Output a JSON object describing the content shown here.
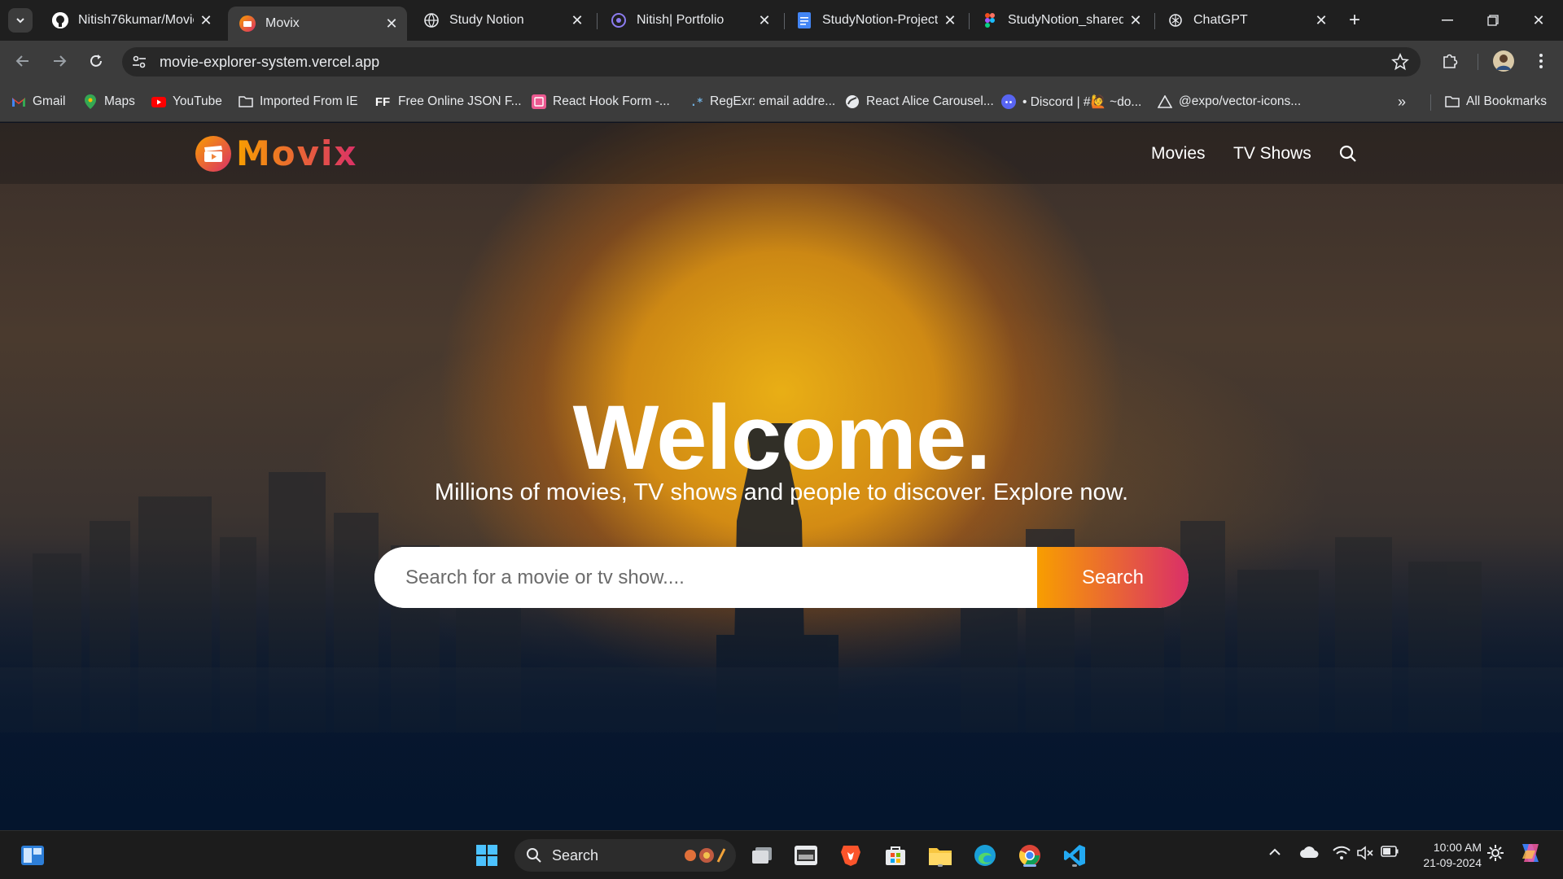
{
  "browser": {
    "tabs": [
      {
        "title": "Nitish76kumar/Movie",
        "icon": "github-icon",
        "active": false
      },
      {
        "title": "Movix",
        "icon": "movix-icon",
        "active": true
      },
      {
        "title": "Study Notion",
        "icon": "globe-icon",
        "active": false
      },
      {
        "title": "Nitish| Portfolio",
        "icon": "portfolio-icon",
        "active": false
      },
      {
        "title": "StudyNotion-Project",
        "icon": "docs-icon",
        "active": false
      },
      {
        "title": "StudyNotion_shared",
        "icon": "figma-icon",
        "active": false
      },
      {
        "title": "ChatGPT",
        "icon": "chatgpt-icon",
        "active": false
      }
    ],
    "url": "movie-explorer-system.vercel.app",
    "bookmarks": [
      {
        "label": "Gmail",
        "icon": "gmail-icon"
      },
      {
        "label": "Maps",
        "icon": "maps-icon"
      },
      {
        "label": "YouTube",
        "icon": "youtube-icon"
      },
      {
        "label": "Imported From IE",
        "icon": "folder-icon"
      },
      {
        "label": "Free Online JSON F...",
        "icon": "ff-icon"
      },
      {
        "label": "React Hook Form -...",
        "icon": "react-hook-form-icon"
      },
      {
        "label": "RegExr: email addre...",
        "icon": "regexr-icon"
      },
      {
        "label": "React Alice Carousel...",
        "icon": "globe-icon"
      },
      {
        "label": "• Discord | #🙋 ~do...",
        "icon": "discord-icon"
      },
      {
        "label": "@expo/vector-icons...",
        "icon": "expo-icon"
      }
    ],
    "all_bookmarks": "All Bookmarks"
  },
  "site": {
    "logo_text": "Movix",
    "nav": {
      "movies": "Movies",
      "tv_shows": "TV Shows"
    },
    "hero": {
      "title": "Welcome.",
      "subtitle": "Millions of movies, TV shows and people to discover. Explore now.",
      "search_placeholder": "Search for a movie or tv show....",
      "search_button": "Search"
    },
    "colors": {
      "gradient_start": "#f89e00",
      "gradient_end": "#da2f68",
      "page_bottom": "#04152d"
    }
  },
  "taskbar": {
    "search_label": "Search",
    "time": "10:00 AM",
    "date": "21-09-2024"
  }
}
